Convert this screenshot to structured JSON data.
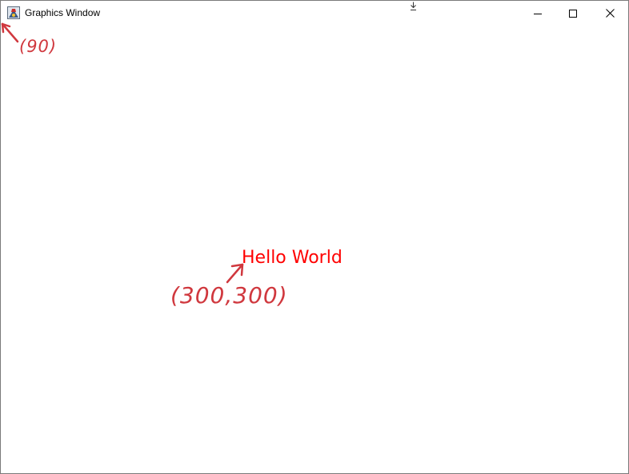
{
  "window": {
    "title": "Graphics Window",
    "controls": {
      "minimize": "minimize",
      "maximize": "maximize",
      "close": "close"
    }
  },
  "canvas": {
    "text": "Hello World",
    "text_color": "#ff0000",
    "background": "#ffffff"
  },
  "annotations": {
    "origin_label": "(90)",
    "point_label": "(300,300)",
    "ink_color": "#d0383e"
  }
}
